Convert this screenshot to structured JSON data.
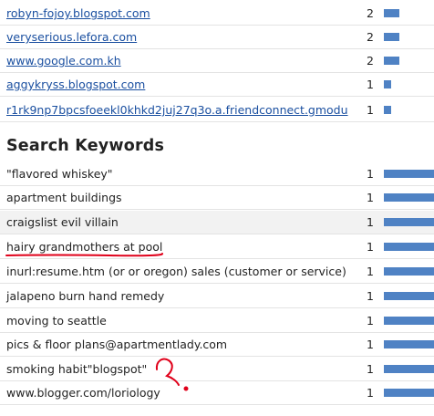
{
  "referrers": [
    {
      "label": "robyn-fojoy.blogspot.com",
      "count": "2",
      "fraction": 0.3
    },
    {
      "label": "veryserious.lefora.com",
      "count": "2",
      "fraction": 0.3
    },
    {
      "label": "www.google.com.kh",
      "count": "2",
      "fraction": 0.3
    },
    {
      "label": "aggykryss.blogspot.com",
      "count": "1",
      "fraction": 0.14
    },
    {
      "label": "r1rk9np7bpcsfoeekl0khkd2juj27q3o.a.friendconnect.gmodu",
      "count": "1",
      "fraction": 0.14
    }
  ],
  "keywords_heading": "Search Keywords",
  "keywords": [
    {
      "label": "\"flavored whiskey\"",
      "count": "1",
      "fraction": 1
    },
    {
      "label": "apartment buildings",
      "count": "1",
      "fraction": 1
    },
    {
      "label": "craigslist evil villain",
      "count": "1",
      "fraction": 1
    },
    {
      "label": "hairy grandmothers at pool",
      "count": "1",
      "fraction": 1
    },
    {
      "label": "inurl:resume.htm (or or oregon) sales (customer or service)",
      "count": "1",
      "fraction": 1
    },
    {
      "label": "jalapeno burn hand remedy",
      "count": "1",
      "fraction": 1
    },
    {
      "label": "moving to seattle",
      "count": "1",
      "fraction": 1
    },
    {
      "label": "pics & floor plans@apartmentlady.com",
      "count": "1",
      "fraction": 1
    },
    {
      "label": "smoking habit\"blogspot\"",
      "count": "1",
      "fraction": 1
    },
    {
      "label": "www.blogger.com/loriology",
      "count": "1",
      "fraction": 1
    }
  ],
  "colors": {
    "bar": "#4f82c4",
    "link": "#1a4fa0",
    "annotation": "#e0001a",
    "highlight_row": "#f2f2f2"
  }
}
